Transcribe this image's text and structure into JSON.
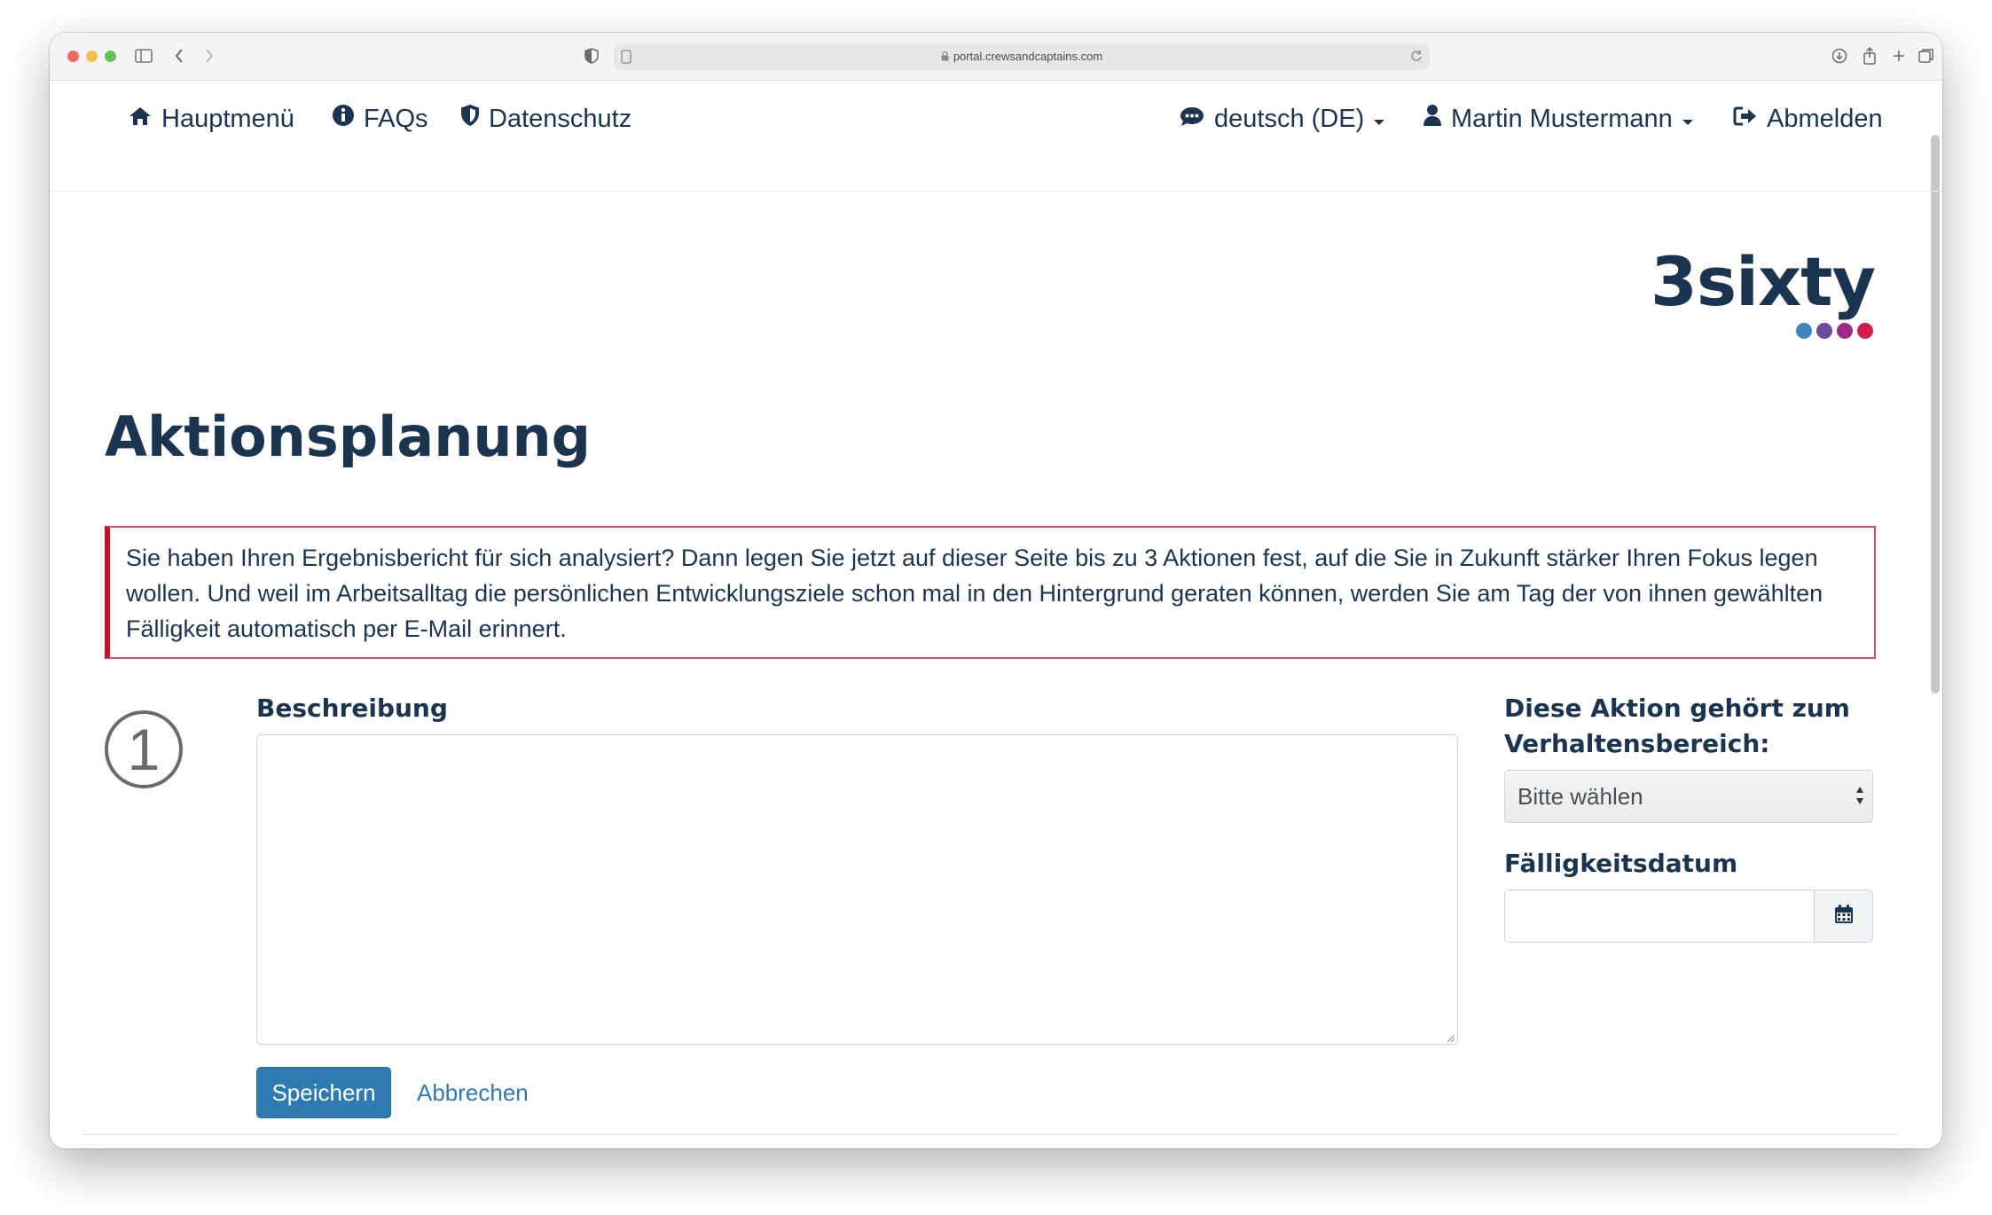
{
  "browser": {
    "url": "portal.crewsandcaptains.com"
  },
  "nav": {
    "home": "Hauptmenü",
    "faqs": "FAQs",
    "privacy": "Datenschutz",
    "language": "deutsch (DE)",
    "user": "Martin Mustermann",
    "logout": "Abmelden"
  },
  "logo": {
    "text": "3sixty",
    "dot_colors": [
      "#3d86c0",
      "#6b4c9a",
      "#9c2a86",
      "#d21c4c"
    ]
  },
  "page": {
    "title": "Aktionsplanung",
    "info": "Sie haben Ihren Ergebnisbericht für sich analysiert? Dann legen Sie jetzt auf dieser Seite bis zu 3 Aktionen fest, auf die Sie in Zukunft stärker Ihren Fokus legen wollen. Und weil im Arbeitsalltag die persönlichen Entwicklungsziele schon mal in den Hintergrund geraten können, werden Sie am Tag der von ihnen gewählten Fälligkeit automatisch per E-Mail erinnert."
  },
  "action": {
    "number": "1",
    "description_label": "Beschreibung",
    "description_value": "",
    "category_label": "Diese Aktion gehört zum Verhaltensbereich:",
    "category_value": "Bitte wählen",
    "due_label": "Fälligkeitsdatum",
    "due_value": "",
    "save": "Speichern",
    "cancel": "Abbrechen"
  },
  "colors": {
    "primary": "#2f7ab0",
    "text": "#1b3550",
    "alert_border": "#c8102e"
  }
}
